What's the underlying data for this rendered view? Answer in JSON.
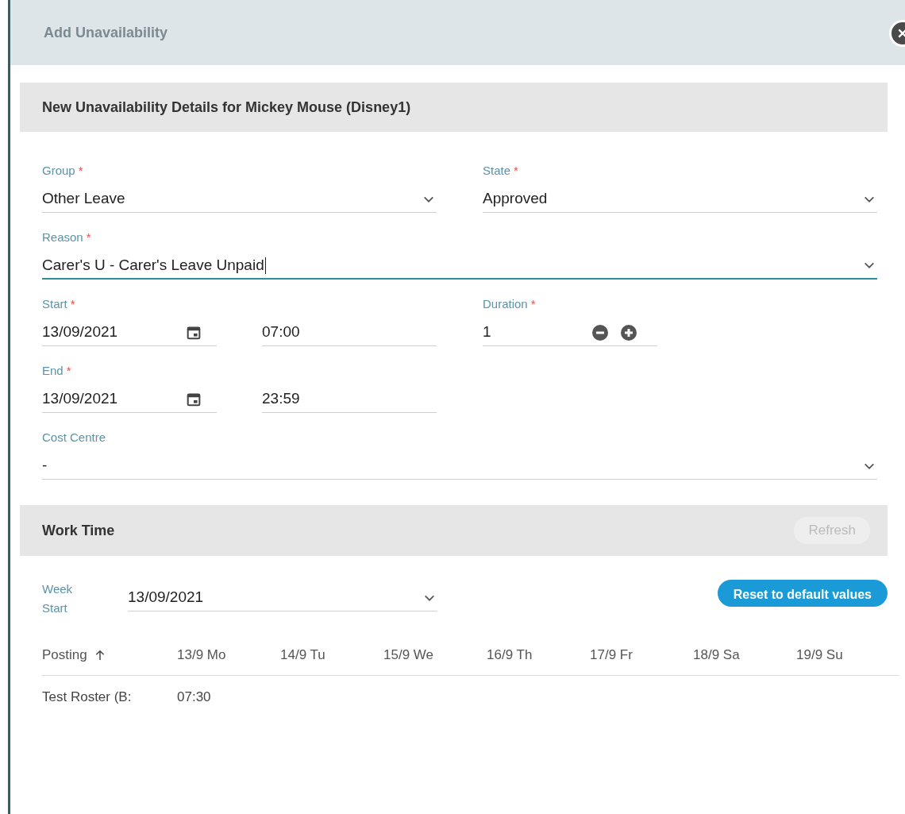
{
  "dialog": {
    "title": "Add Unavailability"
  },
  "details": {
    "heading": "New Unavailability Details for Mickey Mouse (Disney1)",
    "rows": [
      [
        {
          "kind": "select",
          "label": "Group",
          "required_mark": "*",
          "value": "Other Leave",
          "focused": false
        },
        {
          "kind": "select",
          "label": "State",
          "required_mark": "*",
          "value": "Approved",
          "focused": false
        }
      ],
      [
        {
          "kind": "select",
          "label": "Reason",
          "required_mark": "*",
          "value": "Carer's U - Carer's Leave Unpaid",
          "focused": true
        }
      ],
      [
        {
          "kind": "datetime",
          "label": "Start",
          "required_mark": "*",
          "date": "13/09/2021",
          "time": "07:00"
        },
        {
          "kind": "stepper",
          "label": "Duration",
          "required_mark": "*",
          "value": "1"
        }
      ],
      [
        {
          "kind": "datetime",
          "label": "End",
          "required_mark": "*",
          "date": "13/09/2021",
          "time": "23:59"
        }
      ],
      [
        {
          "kind": "select",
          "label": "Cost Centre",
          "value": "-",
          "focused": false
        }
      ]
    ]
  },
  "work_time": {
    "heading": "Work Time",
    "refresh_button": {
      "label": "Refresh",
      "disabled": true
    },
    "week_start": {
      "label": "Week Start",
      "value": "13/09/2021"
    },
    "reset_button": "Reset to default values",
    "table": {
      "columns": [
        "Posting",
        "13/9 Mo",
        "14/9 Tu",
        "15/9 We",
        "16/9 Th",
        "17/9 Fr",
        "18/9 Sa",
        "19/9 Su"
      ],
      "rows": [
        [
          "Test Roster (B:",
          "07:30",
          "",
          "",
          "",
          "",
          "",
          ""
        ]
      ]
    }
  }
}
